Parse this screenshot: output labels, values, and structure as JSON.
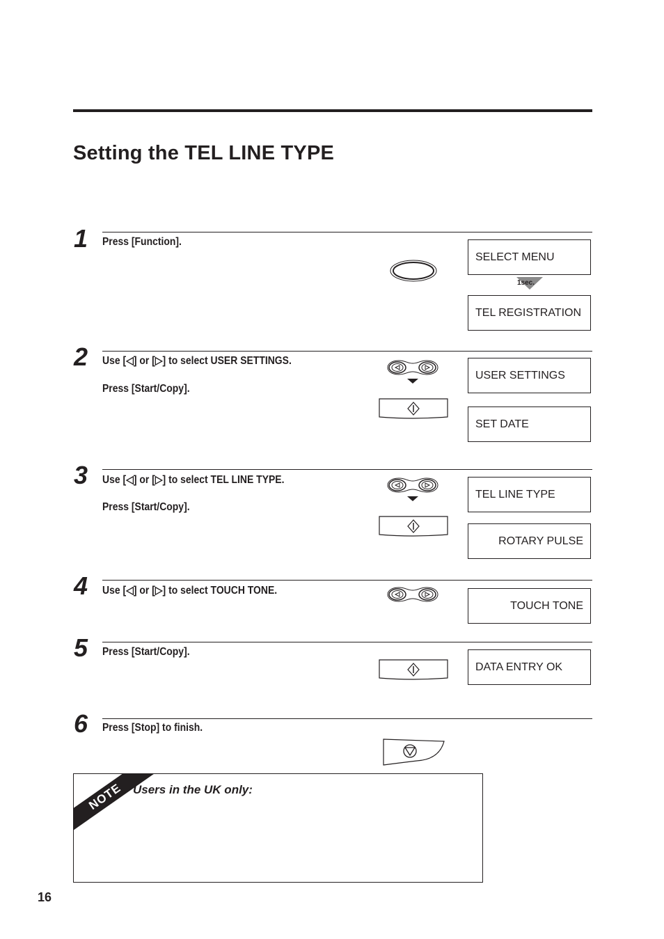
{
  "page": {
    "title": "Setting the TEL LINE TYPE",
    "page_number": "16"
  },
  "steps": [
    {
      "number": "1",
      "instructions": [
        "Press [Function]."
      ],
      "button": "function-button",
      "displays": [
        {
          "text": "SELECT MENU",
          "align": "left"
        },
        {
          "text": "TEL REGISTRATION",
          "align": "left"
        }
      ],
      "delay_label": "1sec."
    },
    {
      "number": "2",
      "instructions": [
        "Use [◁] or [▷] to select USER SETTINGS.",
        "Press [Start/Copy]."
      ],
      "displays": [
        {
          "text": "USER SETTINGS",
          "align": "left"
        },
        {
          "text": "SET DATE",
          "align": "left"
        }
      ]
    },
    {
      "number": "3",
      "instructions": [
        "Use [◁] or [▷] to select TEL LINE TYPE.",
        "Press [Start/Copy]."
      ],
      "displays": [
        {
          "text": "TEL LINE TYPE",
          "align": "left"
        },
        {
          "text": "ROTARY PULSE",
          "align": "right"
        }
      ]
    },
    {
      "number": "4",
      "instructions": [
        "Use [◁] or [▷] to select TOUCH TONE."
      ],
      "displays": [
        {
          "text": "TOUCH TONE",
          "align": "right"
        }
      ]
    },
    {
      "number": "5",
      "instructions": [
        "Press [Start/Copy]."
      ],
      "displays": [
        {
          "text": "DATA ENTRY OK",
          "align": "left"
        }
      ]
    },
    {
      "number": "6",
      "instructions": [
        "Press [Stop] to finish."
      ],
      "displays": []
    }
  ],
  "note": {
    "label": "NOTE",
    "heading": "Users in the UK only:"
  }
}
